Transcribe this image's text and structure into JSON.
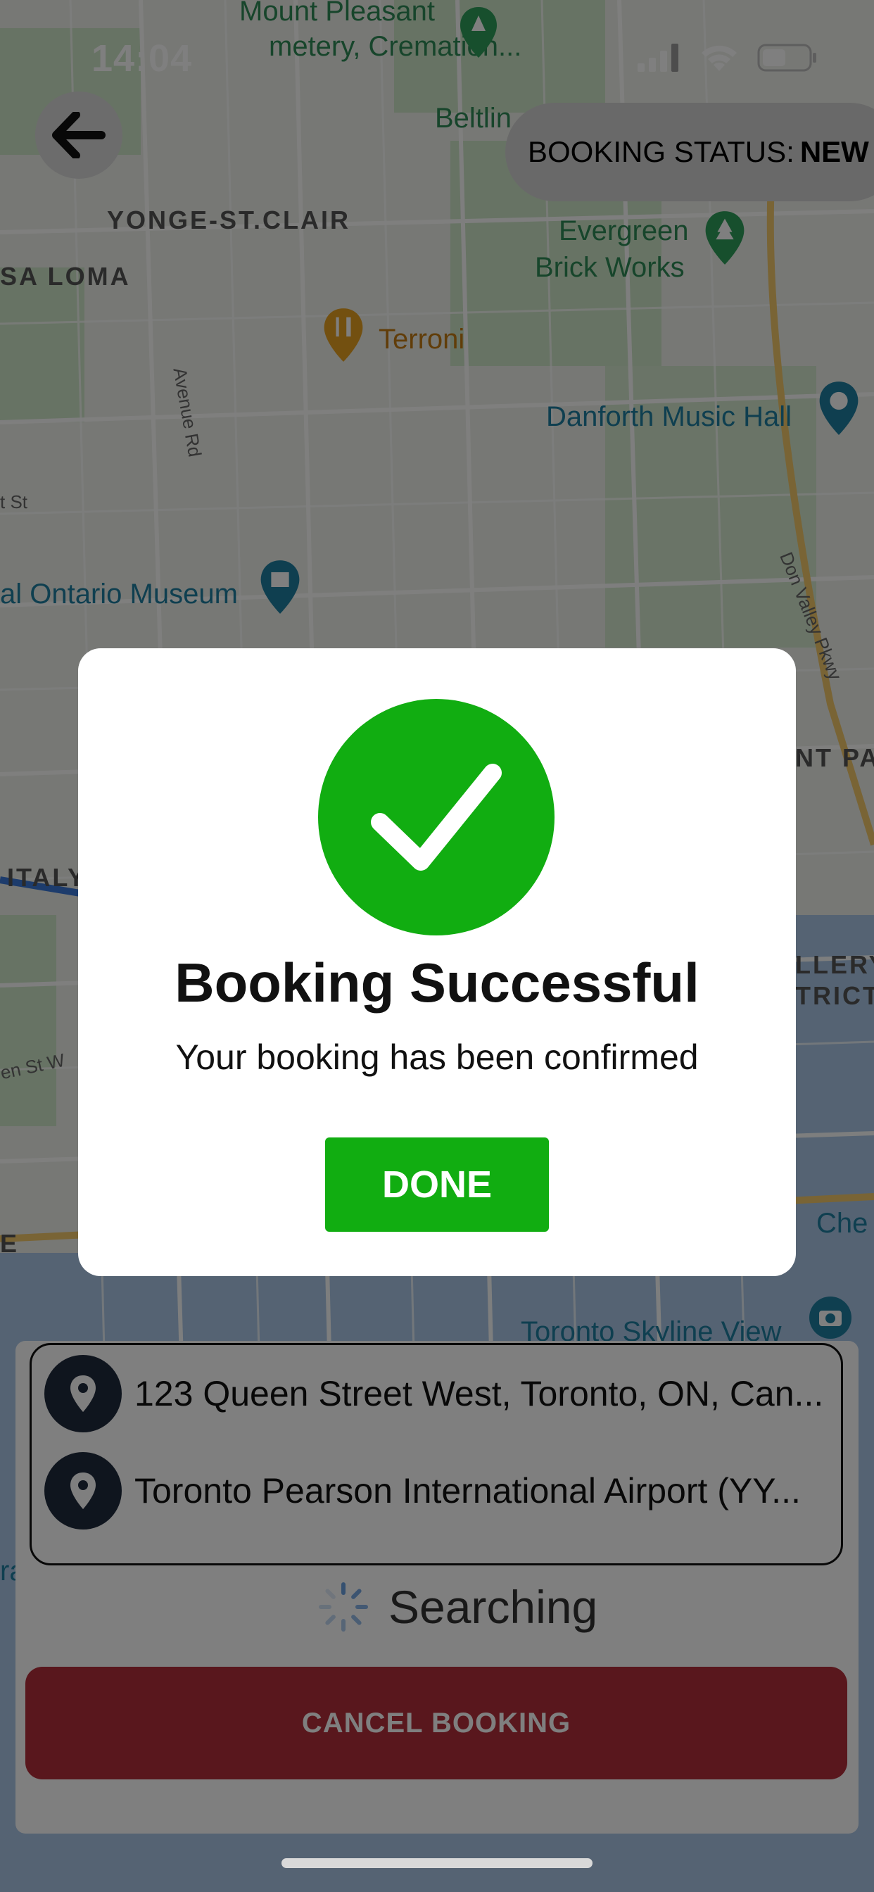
{
  "status_bar": {
    "time": "14:04",
    "icons": [
      "signal-icon",
      "wifi-icon",
      "battery-icon"
    ]
  },
  "map": {
    "labels": {
      "mount_pleasant": "Mount Pleasant",
      "cemetery": "metery, Cremation...",
      "beltline": "Beltlin",
      "yonge_st_clair": "YONGE-ST.CLAIR",
      "casa_loma": "SA LOMA",
      "evergreen": "Evergreen",
      "brick_works": "Brick Works",
      "terroni": "Terroni",
      "avenue_rd": "Avenue Rd",
      "danforth": "Danforth Music Hall",
      "st": "t St",
      "museum": "al Ontario Museum",
      "don_valley": "Don Valley Pkwy",
      "nt_pa": "NT PA",
      "italy": "ITALY",
      "llery": "LLERY",
      "trict": "TRICT",
      "en_st_w": "en St W",
      "che": "Che",
      "e": "E",
      "skyline": "Toronto Skyline View",
      "ra": "ra"
    }
  },
  "top": {
    "booking_status_label": "BOOKING STATUS:",
    "booking_status_value": "NEW"
  },
  "trip": {
    "pickup": "123 Queen Street West, Toronto, ON, Can...",
    "dropoff": "Toronto Pearson International Airport (YY...",
    "searching": "Searching",
    "cancel_label": "CANCEL BOOKING"
  },
  "modal": {
    "title": "Booking Successful",
    "subtitle": "Your booking has been confirmed",
    "done_label": "DONE"
  },
  "colors": {
    "success_green": "#11ad11",
    "cancel_red": "#b32f3a",
    "pin_dark": "#1f2a3c"
  }
}
